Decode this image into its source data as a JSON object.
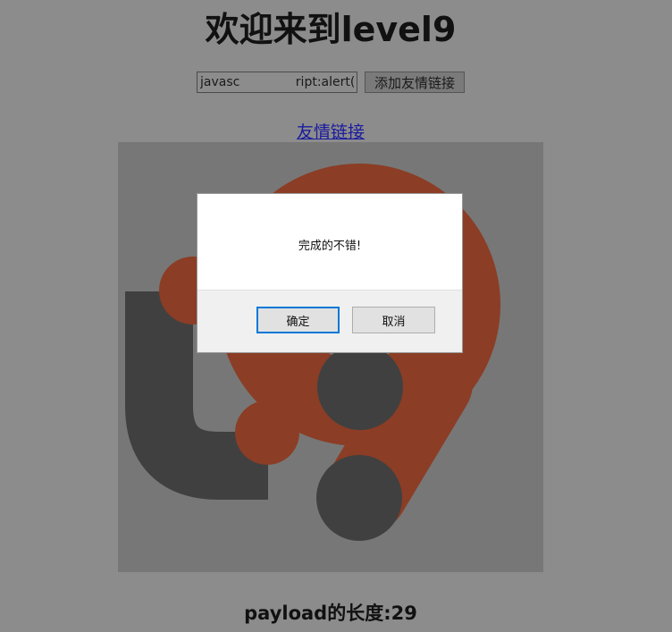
{
  "page": {
    "title": "欢迎来到level9",
    "payload_length": "payload的长度:29"
  },
  "form": {
    "input_value": "javasc\t\tript:alert('htt",
    "submit_label": "添加友情链接"
  },
  "friend_link": {
    "label": "友情链接"
  },
  "logo": {
    "colors": {
      "background": "#777777",
      "red": "#8b3d25",
      "dark": "#404040"
    }
  },
  "dialog": {
    "message": "完成的不错!",
    "ok_label": "确定",
    "cancel_label": "取消"
  }
}
